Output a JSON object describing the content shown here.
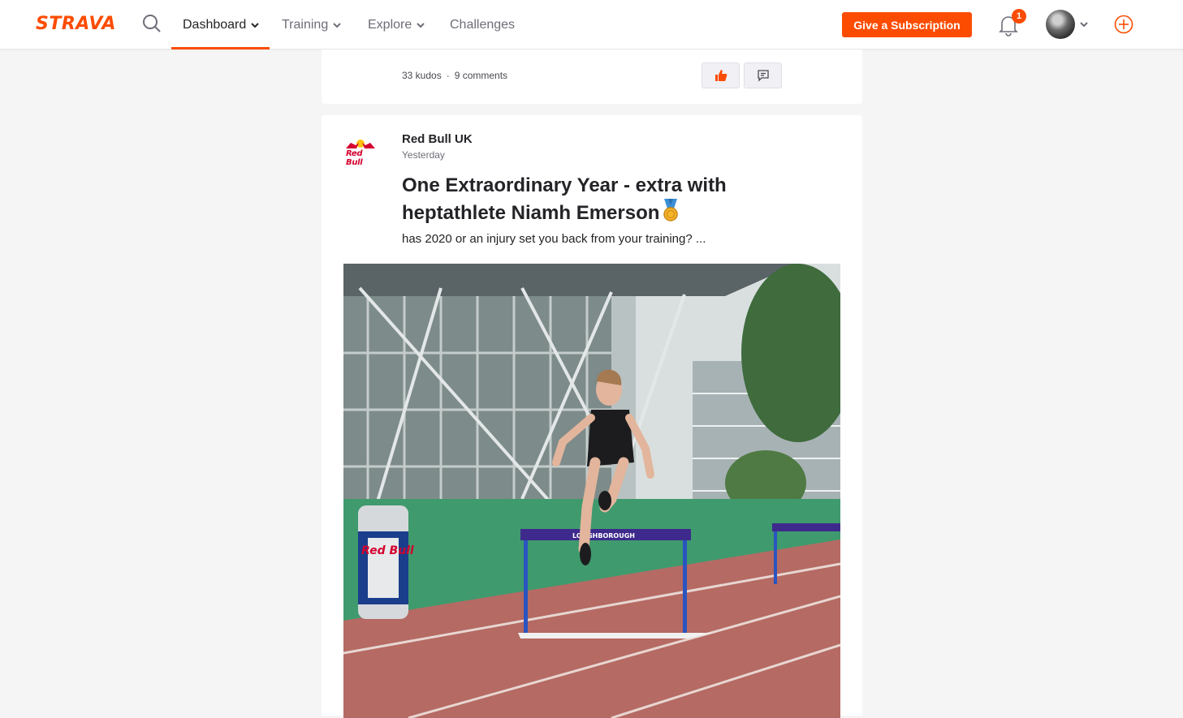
{
  "brand": {
    "logo_text": "STRAVA",
    "accent_color": "#fc4c02"
  },
  "nav": {
    "items": [
      {
        "label": "Dashboard",
        "active": true,
        "has_dropdown": true
      },
      {
        "label": "Training",
        "active": false,
        "has_dropdown": true
      },
      {
        "label": "Explore",
        "active": false,
        "has_dropdown": true
      },
      {
        "label": "Challenges",
        "active": false,
        "has_dropdown": false
      }
    ],
    "subscription_button": "Give a Subscription",
    "notification_count": "1"
  },
  "previous_post": {
    "kudos": "33 kudos",
    "comments": "9 comments"
  },
  "post": {
    "club_name": "Red Bull UK",
    "logo_text": "Red Bull",
    "time": "Yesterday",
    "title": "One Extraordinary Year - extra with heptathlete Niamh Emerson",
    "excerpt": "has 2020 or an injury set you back from your training? ...",
    "image": {
      "hurdle_text": "LOUGHBOROUGH",
      "can_text": "Red Bull"
    }
  }
}
